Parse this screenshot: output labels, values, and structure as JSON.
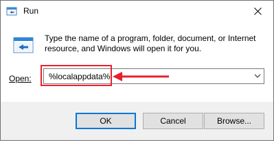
{
  "window": {
    "title": "Run",
    "description": "Type the name of a program, folder, document, or Internet resource, and Windows will open it for you.",
    "open_label": "Open:",
    "open_value": "%localappdata%",
    "buttons": {
      "ok": "OK",
      "cancel": "Cancel",
      "browse": "Browse..."
    }
  },
  "icons": {
    "title": "run-icon",
    "dialog": "run-icon",
    "close": "close-icon",
    "dropdown": "chevron-down-icon",
    "annotation_arrow": "arrow-left-icon"
  },
  "colors": {
    "highlight": "#e8202a",
    "default_button_border": "#0078d7"
  }
}
